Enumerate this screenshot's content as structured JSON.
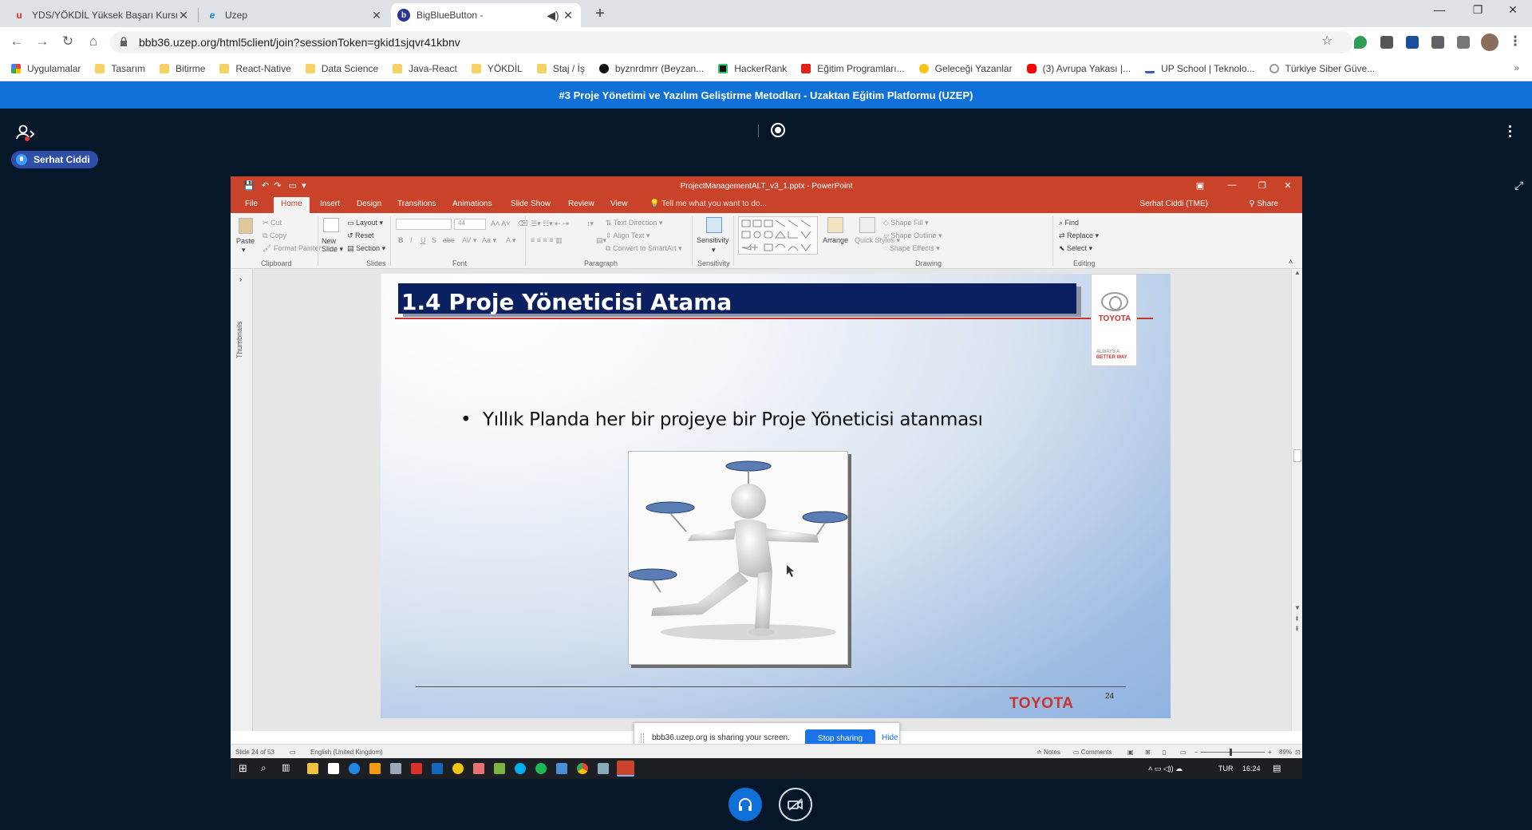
{
  "browser": {
    "tabs": [
      {
        "title": "YDS/YÖKDİL Yüksek Başarı Kursu",
        "icon": "yds-favicon",
        "color": "#d93025"
      },
      {
        "title": "Uzep",
        "icon": "ie-favicon",
        "color": "#1e88e5"
      },
      {
        "title": "BigBlueButton -",
        "icon": "bbb-favicon",
        "color": "#283593",
        "active": true
      }
    ],
    "url": "bbb36.uzep.org/html5client/join?sessionToken=gkid1sjqvr41kbnv",
    "bookmarks": [
      {
        "label": "Uygulamalar",
        "icon": "apps-grid-icon"
      },
      {
        "label": "Tasarım",
        "icon": "folder-icon"
      },
      {
        "label": "Bitirme",
        "icon": "folder-icon"
      },
      {
        "label": "React-Native",
        "icon": "folder-icon"
      },
      {
        "label": "Data Science",
        "icon": "folder-icon"
      },
      {
        "label": "Java-React",
        "icon": "folder-icon"
      },
      {
        "label": "YÖKDİL",
        "icon": "folder-icon"
      },
      {
        "label": "Staj / İş",
        "icon": "folder-icon"
      },
      {
        "label": "byznrdmrr (Beyzan...",
        "icon": "github-icon"
      },
      {
        "label": "HackerRank",
        "icon": "hackerrank-icon"
      },
      {
        "label": "Eğitim Programları...",
        "icon": "acrobat-icon"
      },
      {
        "label": "Geleceği Yazanlar",
        "icon": "gy-icon"
      },
      {
        "label": "(3) Avrupa Yakası |...",
        "icon": "youtube-icon"
      },
      {
        "label": "UP School | Teknolo...",
        "icon": "upschool-icon"
      },
      {
        "label": "Türkiye Siber Güve...",
        "icon": "tsg-icon"
      }
    ],
    "bookmarks_more": "»"
  },
  "bbb": {
    "meeting_title": "#3 Proje Yönetimi ve Yazılım Geliştirme Metodları - Uzaktan Eğitim Platformu (UZEP)",
    "talker": "Serhat Ciddi"
  },
  "powerpoint": {
    "window_title": "ProjectManagementALT_v3_1.pptx - PowerPoint",
    "tabs": [
      "File",
      "Home",
      "Insert",
      "Design",
      "Transitions",
      "Animations",
      "Slide Show",
      "Review",
      "View"
    ],
    "active_tab": "Home",
    "tell_me": "Tell me what you want to do...",
    "user": "Serhat Ciddi (TME)",
    "share": "Share",
    "ribbon": {
      "clipboard": {
        "paste": "Paste",
        "cut": "Cut",
        "copy": "Copy",
        "format_painter": "Format Painter",
        "label": "Clipboard"
      },
      "slides": {
        "new_slide": "New Slide",
        "layout": "Layout",
        "reset": "Reset",
        "section": "Section",
        "label": "Slides"
      },
      "font": {
        "size": "44",
        "label": "Font"
      },
      "paragraph": {
        "text_direction": "Text Direction",
        "align_text": "Align Text",
        "smartart": "Convert to SmartArt",
        "label": "Paragraph"
      },
      "sensitivity": {
        "button": "Sensitivity",
        "label": "Sensitivity"
      },
      "drawing": {
        "arrange": "Arrange",
        "quick_styles": "Quick Styles",
        "shape_fill": "Shape Fill",
        "shape_outline": "Shape Outline",
        "shape_effects": "Shape Effects",
        "label": "Drawing"
      },
      "editing": {
        "find": "Find",
        "replace": "Replace",
        "select": "Select",
        "label": "Editing"
      }
    },
    "thumbnails_label": "Thumbnails",
    "slide": {
      "title": "1.4 Proje Yöneticisi Atama",
      "bullet": "Yıllık Planda her bir projeye bir Proje Yöneticisi atanması",
      "logo_word": "TOYOTA",
      "logo_tag_1": "ALWAYS A",
      "logo_tag_2": "BETTER WAY",
      "footer_brand": "TOYOTA",
      "number": "24"
    },
    "status": {
      "slide_of": "Slide 24 of 53",
      "language": "English (United Kingdom)",
      "notes": "Notes",
      "comments": "Comments",
      "zoom": "89%"
    }
  },
  "share_notice": {
    "message": "bbb36.uzep.org is sharing your screen.",
    "stop": "Stop sharing",
    "hide": "Hide"
  },
  "taskbar": {
    "lang": "TUR",
    "time": "16:24"
  }
}
